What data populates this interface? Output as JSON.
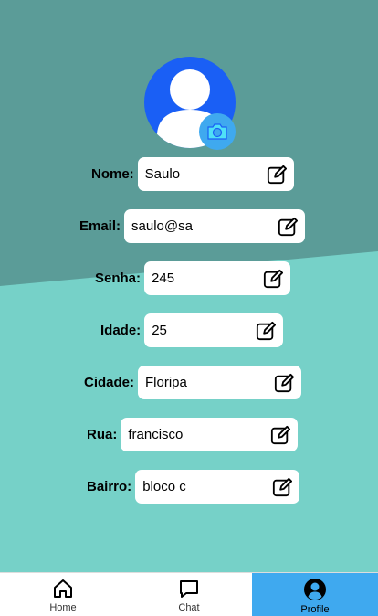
{
  "colors": {
    "bg_top": "#5b9c98",
    "bg_bottom": "#76d1c8",
    "avatar_blue": "#1a5ff5",
    "camera_blue": "#3fa9ef",
    "active_tab": "#3fa9ef"
  },
  "profile": {
    "fields": [
      {
        "label": "Nome:",
        "value": "Saulo"
      },
      {
        "label": "Email:",
        "value": "saulo@sa"
      },
      {
        "label": "Senha:",
        "value": "245"
      },
      {
        "label": "Idade:",
        "value": "25"
      },
      {
        "label": "Cidade:",
        "value": "Floripa"
      },
      {
        "label": "Rua:",
        "value": "francisco"
      },
      {
        "label": "Bairro:",
        "value": "bloco c"
      }
    ]
  },
  "tabs": [
    {
      "label": "Home",
      "icon": "home-icon",
      "active": false
    },
    {
      "label": "Chat",
      "icon": "chat-icon",
      "active": false
    },
    {
      "label": "Profile",
      "icon": "profile-icon",
      "active": true
    }
  ]
}
